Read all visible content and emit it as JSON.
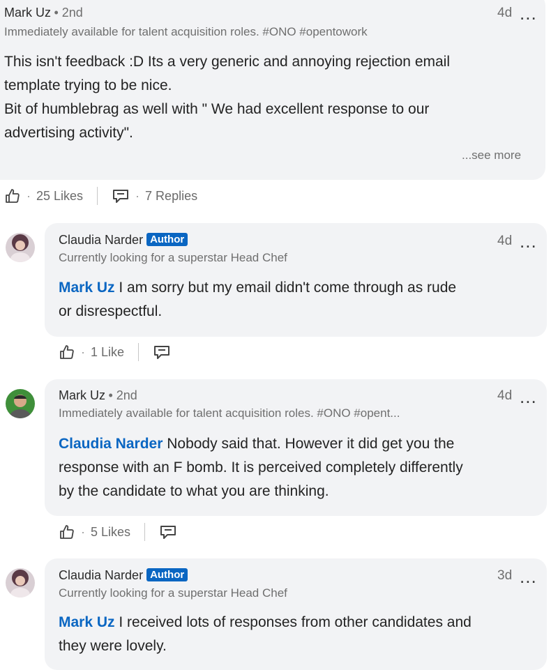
{
  "comment1": {
    "name": "Mark Uz",
    "degree": "• 2nd",
    "headline": "Immediately available for talent acquisition roles. #ONO #opentowork",
    "time": "4d",
    "more": "...",
    "lines": [
      "This isn't feedback :D Its a very generic and annoying rejection email",
      "template trying to be nice.",
      "Bit of humblebrag as well with \" We had excellent response to our",
      "advertising activity\"."
    ],
    "see_more": "...see more",
    "likes": "25 Likes",
    "replies": "7 Replies"
  },
  "reply1": {
    "name": "Claudia Narder",
    "badge": "Author",
    "headline": "Currently looking for a superstar Head Chef",
    "time": "4d",
    "more": "...",
    "mention": "Mark Uz",
    "line1": " I am sorry but my email didn't come through as rude",
    "line2": "or disrespectful.",
    "likes": "1 Like"
  },
  "reply2": {
    "name": "Mark Uz",
    "degree": "• 2nd",
    "headline": "Immediately available for talent acquisition roles. #ONO #opent...",
    "time": "4d",
    "more": "...",
    "mention": "Claudia Narder",
    "line1": " Nobody said that. However it did get you the",
    "line2": "response with an F bomb. It is perceived completely differently",
    "line3": "by the candidate to what you are thinking.",
    "likes": "5 Likes"
  },
  "reply3": {
    "name": "Claudia Narder",
    "badge": "Author",
    "headline": "Currently looking for a superstar Head Chef",
    "time": "3d",
    "more": "...",
    "mention": "Mark Uz",
    "line1": " I received lots of responses from other candidates and",
    "line2": "they were lovely."
  },
  "colors": {
    "bubble": "#f2f3f5",
    "mention": "#0a66c2",
    "badge": "#0a66c2"
  }
}
